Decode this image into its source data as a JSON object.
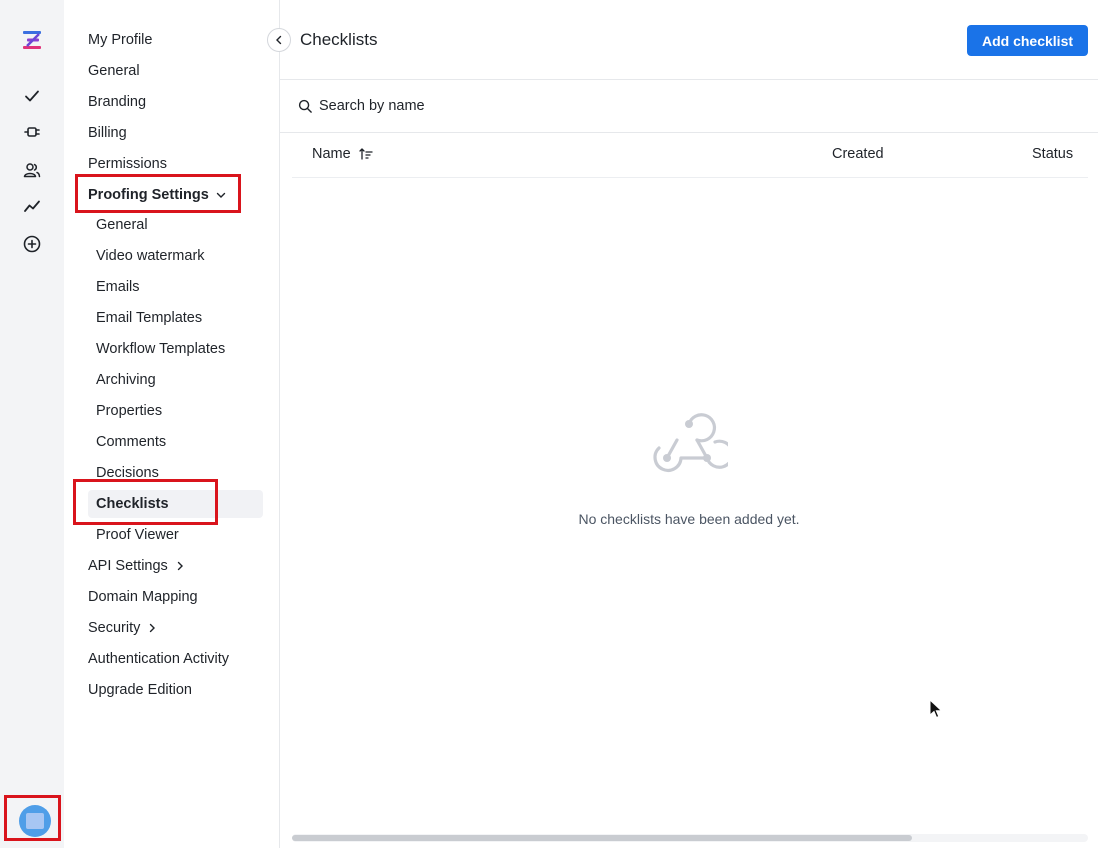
{
  "rail": {
    "icons": [
      "logo-icon",
      "check-icon",
      "plug-icon",
      "users-icon",
      "activity-icon",
      "add-circle-icon",
      "avatar"
    ]
  },
  "sidebar": {
    "items": [
      {
        "label": "My Profile"
      },
      {
        "label": "General"
      },
      {
        "label": "Branding"
      },
      {
        "label": "Billing"
      },
      {
        "label": "Permissions"
      },
      {
        "label": "Proofing Settings"
      },
      {
        "label": "API Settings"
      },
      {
        "label": "Domain Mapping"
      },
      {
        "label": "Security"
      },
      {
        "label": "Authentication Activity"
      },
      {
        "label": "Upgrade Edition"
      }
    ],
    "proofing_sub": [
      {
        "label": "General"
      },
      {
        "label": "Video watermark"
      },
      {
        "label": "Emails"
      },
      {
        "label": "Email Templates"
      },
      {
        "label": "Workflow Templates"
      },
      {
        "label": "Archiving"
      },
      {
        "label": "Properties"
      },
      {
        "label": "Comments"
      },
      {
        "label": "Decisions"
      },
      {
        "label": "Checklists"
      },
      {
        "label": "Proof Viewer"
      }
    ]
  },
  "main": {
    "title": "Checklists",
    "add_button": "Add checklist",
    "search_placeholder": "Search by name",
    "columns": {
      "name": "Name",
      "created": "Created",
      "status": "Status"
    },
    "empty_message": "No checklists have been added yet."
  },
  "colors": {
    "accent": "#1a73e8",
    "highlight": "#d9141c"
  }
}
